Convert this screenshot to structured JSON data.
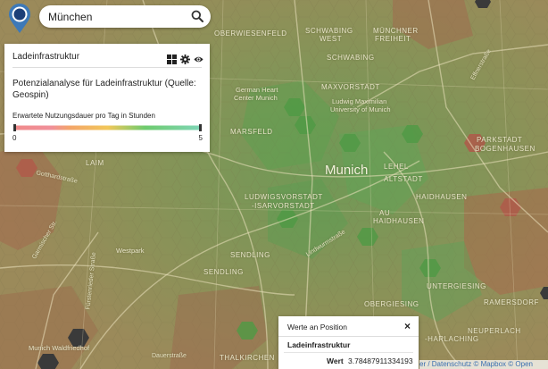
{
  "search": {
    "value": "München",
    "placeholder": ""
  },
  "legend": {
    "title": "Ladeinfrastruktur",
    "description": "Potenzialanalyse für Ladeinfrastruktur (Quelle: Geospin)",
    "scale_label": "Erwartete Nutzungsdauer pro Tag in Stunden",
    "min": "0",
    "max": "5",
    "colors": [
      "#f08a8a",
      "#f3a56a",
      "#f2c75a",
      "#b9d85a",
      "#6ecb6e",
      "#7fd6b8"
    ]
  },
  "map_labels": {
    "city": "Munich",
    "districts": [
      "OBERWIESENFELD",
      "SCHWABING",
      "WEST",
      "MÜNCHNER",
      "FREIHEIT",
      "SCHWABING",
      "MAXVORSTADT",
      "MARSFELD",
      "LEHEL",
      "ALTSTADT",
      "LUDWIGSVORSTADT",
      "-ISARVORSTADT",
      "HAIDHAUSEN",
      "AU",
      "HAIDHAUSEN",
      "PARKSTADT",
      "BOGENHAUSEN",
      "SENDLING",
      "SENDLING",
      "OBERGIESING",
      "UNTERGIESING",
      "-HARLACHING",
      "LAIM",
      "THALKIRCHEN",
      "RAMERSDORF",
      "NEUPERLACH"
    ],
    "pois": [
      "German Heart",
      "Center Munich",
      "Ludwig Maximilian",
      "University of Munich",
      "Westpark",
      "Munich Waldfriedhof"
    ],
    "streets": [
      "Gotthardstraße",
      "Fürstenrieder Straße",
      "Garmischer Str.",
      "Lindwurmstraße",
      "Dauerstraße",
      "Effnerstraße"
    ]
  },
  "popup": {
    "title": "Werte an Position",
    "close": "×",
    "layer": "Ladeinfrastruktur",
    "key": "Wert",
    "value": "3.78487911334193"
  },
  "attribution": "er / Datenschutz © Mapbox © Open"
}
